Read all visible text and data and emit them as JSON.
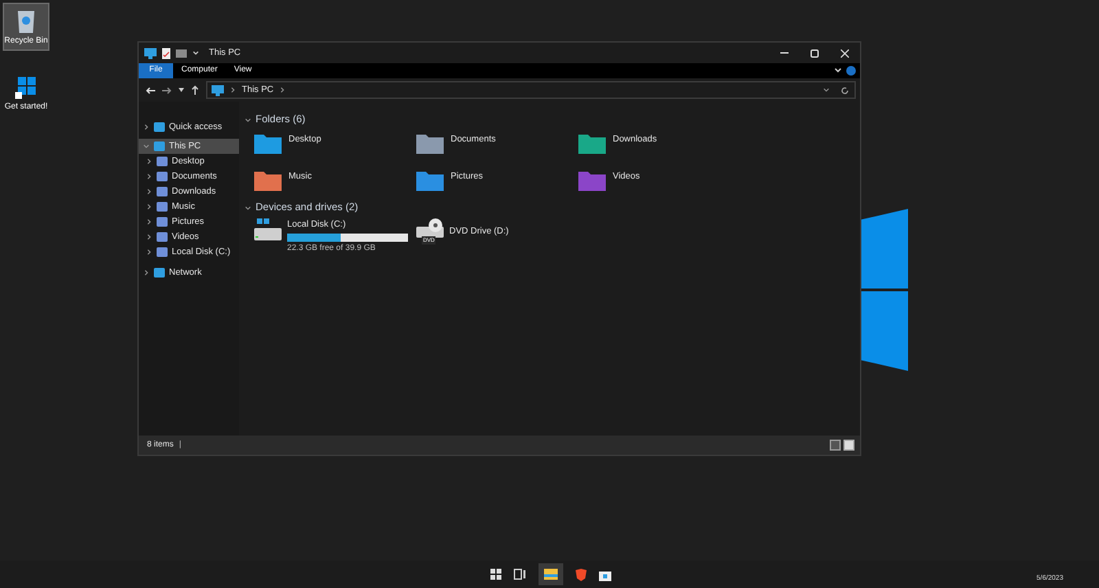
{
  "desktop_icons": [
    {
      "label": "Recycle Bin",
      "selected": true
    },
    {
      "label": "Get started!",
      "selected": false
    }
  ],
  "window": {
    "title": "This PC"
  },
  "ribbon_tabs": [
    {
      "label": "File",
      "selected": true
    },
    {
      "label": "Computer",
      "selected": false
    },
    {
      "label": "View",
      "selected": false
    }
  ],
  "address_bar": {
    "path": "This PC"
  },
  "sidebar": {
    "items": [
      {
        "label": "Quick access",
        "expanded": false,
        "selected": false
      },
      {
        "label": "This PC",
        "expanded": true,
        "selected": true,
        "children": [
          {
            "label": "Desktop",
            "expanded": false,
            "selected": false
          },
          {
            "label": "Documents",
            "expanded": false,
            "selected": false
          },
          {
            "label": "Downloads",
            "expanded": false,
            "selected": false
          },
          {
            "label": "Music",
            "expanded": false,
            "selected": false
          },
          {
            "label": "Pictures",
            "expanded": false,
            "selected": false
          },
          {
            "label": "Videos",
            "expanded": false,
            "selected": false
          },
          {
            "label": "Local Disk (C:)",
            "expanded": false,
            "selected": false
          }
        ]
      },
      {
        "label": "Network",
        "expanded": false,
        "selected": false
      }
    ]
  },
  "folders": {
    "heading": "Folders (6)",
    "expanded": true,
    "items": [
      {
        "label": "Desktop"
      },
      {
        "label": "Documents"
      },
      {
        "label": "Downloads"
      },
      {
        "label": "Music"
      },
      {
        "label": "Pictures"
      },
      {
        "label": "Videos"
      }
    ]
  },
  "drives": {
    "heading": "Devices and drives (2)",
    "expanded": true,
    "items": [
      {
        "kind": "disk",
        "label": "Local Disk (C:)",
        "level": 0.44,
        "free_text": "22.3 GB free of 39.9 GB"
      },
      {
        "kind": "dvd",
        "label": "DVD Drive (D:)",
        "badge": "DVD"
      }
    ]
  },
  "status_bar": {
    "count": "8 items",
    "separator": "|"
  },
  "taskbar": {
    "date": "5/6/2023"
  }
}
